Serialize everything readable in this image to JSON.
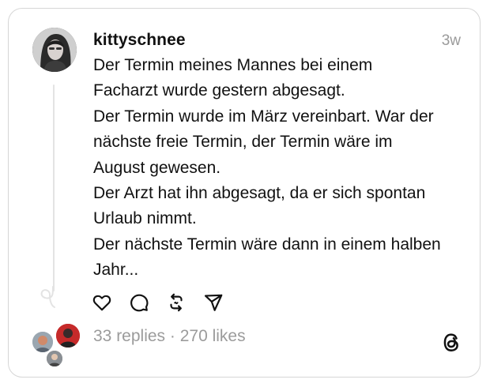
{
  "post": {
    "username": "kittyschnee",
    "time": "3w",
    "lines": [
      "Der Termin meines Mannes bei einem",
      "Facharzt wurde gestern abgesagt.",
      "Der Termin wurde im März vereinbart. War der",
      "nächste freie Termin, der Termin wäre im",
      "August gewesen.",
      "Der Arzt hat ihn abgesagt, da er sich spontan",
      "Urlaub nimmt.",
      "Der nächste Termin wäre dann in einem halben",
      "Jahr..."
    ],
    "stats": "33 replies · 270 likes"
  },
  "icons": {
    "like": "heart-icon",
    "reply": "comment-icon",
    "repost": "repost-icon",
    "share": "send-icon",
    "brand": "threads-logo-icon"
  },
  "colors": {
    "text": "#111111",
    "muted": "#9b9b9b",
    "border": "#d6d6d6"
  }
}
